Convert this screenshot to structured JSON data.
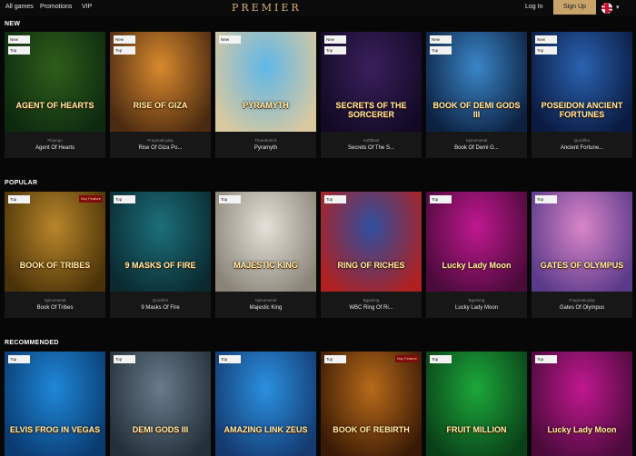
{
  "header": {
    "nav": [
      "All games",
      "Promotions",
      "VIP"
    ],
    "logo": "PREMIER",
    "login": "Log In",
    "signup": "Sign Up"
  },
  "sections": [
    {
      "title": "NEW",
      "games": [
        {
          "art": "AGENT OF HEARTS",
          "provider": "Playngo",
          "name": "Agent Of Hearts",
          "badges": [
            "New",
            "Top"
          ],
          "colors": [
            "#2e5e1a",
            "#0d2a10"
          ]
        },
        {
          "art": "RISE OF GIZA",
          "provider": "Pragmaticplay",
          "name": "Rise Of Giza Po...",
          "badges": [
            "New",
            "Top"
          ],
          "colors": [
            "#d9892e",
            "#4a2a10"
          ]
        },
        {
          "art": "PYRAMYTH",
          "provider": "Thunderkick",
          "name": "Pyramyth",
          "badges": [
            "New"
          ],
          "colors": [
            "#5fb7e8",
            "#d9c9a0"
          ]
        },
        {
          "art": "SECRETS OF THE SORCERER",
          "provider": "Softblast",
          "name": "Secrets Of The S...",
          "badges": [
            "New",
            "Top"
          ],
          "colors": [
            "#3a1f5c",
            "#120a25"
          ]
        },
        {
          "art": "BOOK OF DEMI GODS III",
          "provider": "Spinomenal",
          "name": "Book Of Demi G...",
          "badges": [
            "New",
            "Top"
          ],
          "colors": [
            "#3a86c8",
            "#0c2040"
          ]
        },
        {
          "art": "POSEIDON ANCIENT FORTUNES",
          "provider": "Quickfire",
          "name": "Ancient Fortune...",
          "badges": [
            "New",
            "Top"
          ],
          "colors": [
            "#2a62b0",
            "#0a1a40"
          ]
        }
      ]
    },
    {
      "title": "POPULAR",
      "games": [
        {
          "art": "BOOK OF TRIBES",
          "provider": "Spinomenal",
          "name": "Book Of Tribes",
          "badges": [
            "Top"
          ],
          "buy": "Buy Feature",
          "colors": [
            "#b8862a",
            "#4a3208"
          ]
        },
        {
          "art": "9 MASKS OF FIRE",
          "provider": "Quickfire",
          "name": "9 Masks Of Fire",
          "badges": [
            "Top"
          ],
          "colors": [
            "#1c6f7a",
            "#0a2a30"
          ]
        },
        {
          "art": "MAJESTIC KING",
          "provider": "Spinomenal",
          "name": "Majestic King",
          "badges": [
            "Top"
          ],
          "colors": [
            "#e5e1d8",
            "#8a8478"
          ]
        },
        {
          "art": "RING OF RICHES",
          "provider": "Bgaming",
          "name": "WBC Ring Of Ri...",
          "badges": [
            "Top"
          ],
          "colors": [
            "#2e4fa0",
            "#b02020"
          ]
        },
        {
          "art": "Lucky Lady Moon",
          "provider": "Bgaming",
          "name": "Lucky Lady Moon",
          "badges": [
            "Top"
          ],
          "colors": [
            "#c01890",
            "#4a0a3a"
          ]
        },
        {
          "art": "GATES OF OLYMPUS",
          "provider": "Pragmaticplay",
          "name": "Gates Of Olympus",
          "badges": [
            "Top"
          ],
          "colors": [
            "#d985c8",
            "#5a3a8a"
          ]
        }
      ]
    },
    {
      "title": "RECOMMENDED",
      "games": [
        {
          "art": "ELVIS FROG IN VEGAS",
          "provider": "",
          "name": "",
          "badges": [
            "Top"
          ],
          "colors": [
            "#1e88d8",
            "#0a3a70"
          ]
        },
        {
          "art": "DEMI GODS III",
          "provider": "",
          "name": "",
          "badges": [
            "Top"
          ],
          "colors": [
            "#6a7a8a",
            "#22303a"
          ]
        },
        {
          "art": "AMAZING LINK ZEUS",
          "provider": "",
          "name": "",
          "badges": [
            "Top"
          ],
          "colors": [
            "#2a90e0",
            "#143a70"
          ]
        },
        {
          "art": "BOOK OF REBIRTH",
          "provider": "",
          "name": "",
          "badges": [
            "Top"
          ],
          "buy": "Buy Feature",
          "colors": [
            "#b86a1a",
            "#3a1a05"
          ]
        },
        {
          "art": "FRUIT MILLION",
          "provider": "",
          "name": "",
          "badges": [
            "Top"
          ],
          "colors": [
            "#1ca83a",
            "#0a4018"
          ]
        },
        {
          "art": "Lucky Lady Moon",
          "provider": "",
          "name": "",
          "badges": [
            "Top"
          ],
          "colors": [
            "#c01890",
            "#4a0a3a"
          ]
        }
      ]
    }
  ]
}
